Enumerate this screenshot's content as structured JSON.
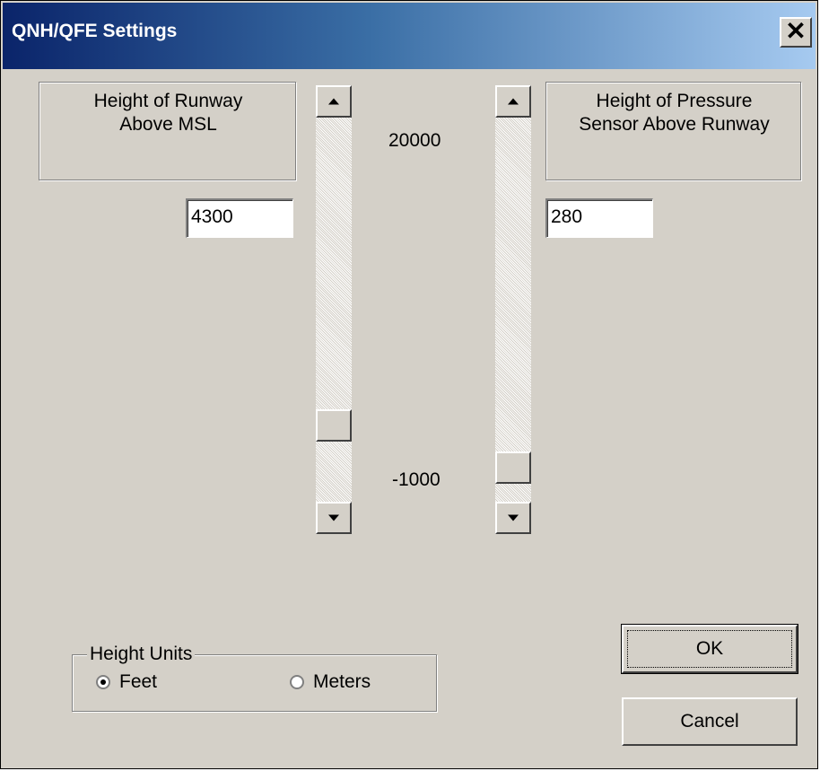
{
  "window": {
    "title": "QNH/QFE Settings",
    "close_glyph": "✕"
  },
  "runway": {
    "label_line1": "Height of Runway",
    "label_line2": "Above MSL",
    "value": "4300",
    "slider_level": 0.17
  },
  "sensor": {
    "label_line1": "Height of Pressure",
    "label_line2": "Sensor Above Runway",
    "value": "280",
    "slider_level": 0.05
  },
  "scale": {
    "max": "20000",
    "min": "-1000"
  },
  "units": {
    "group_label": "Height Units",
    "options": [
      "Feet",
      "Meters"
    ],
    "selected": "Feet"
  },
  "buttons": {
    "ok": "OK",
    "cancel": "Cancel"
  },
  "icons": {
    "close": "close-icon",
    "scroll_up": "up-arrow-icon",
    "scroll_down": "down-arrow-icon",
    "radio": "radio-button-icon"
  }
}
